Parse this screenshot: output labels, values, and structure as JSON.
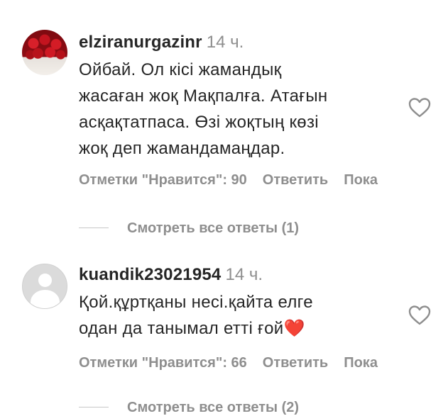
{
  "comments": [
    {
      "username": "elziranurgazinr",
      "time": "14 ч.",
      "text_lines": [
        "Ойбай. Ол кісі жамандық",
        "жасаған жоқ Мақпалға. Атағын",
        "асқақтатпаса. Өзі жоқтың көзі",
        "жоқ деп жамандамаңдар."
      ],
      "likes_label": "Отметки \"Нравится\": 90",
      "reply_label": "Ответить",
      "more_label": "Пока",
      "view_replies": "Смотреть все ответы (1)",
      "avatar": "roses-photo"
    },
    {
      "username": "kuandik23021954",
      "time": "14 ч.",
      "text_lines": [
        "Қой.құртқаны несі.қайта елге",
        "одан да танымал етті ғой❤️"
      ],
      "likes_label": "Отметки \"Нравится\": 66",
      "reply_label": "Ответить",
      "more_label": "Пока",
      "view_replies": "Смотреть все ответы (2)",
      "avatar": "default-user"
    }
  ],
  "icons": {
    "like": "heart-outline-icon"
  },
  "colors": {
    "primary_text": "#262626",
    "secondary_text": "#8e8e8e"
  }
}
